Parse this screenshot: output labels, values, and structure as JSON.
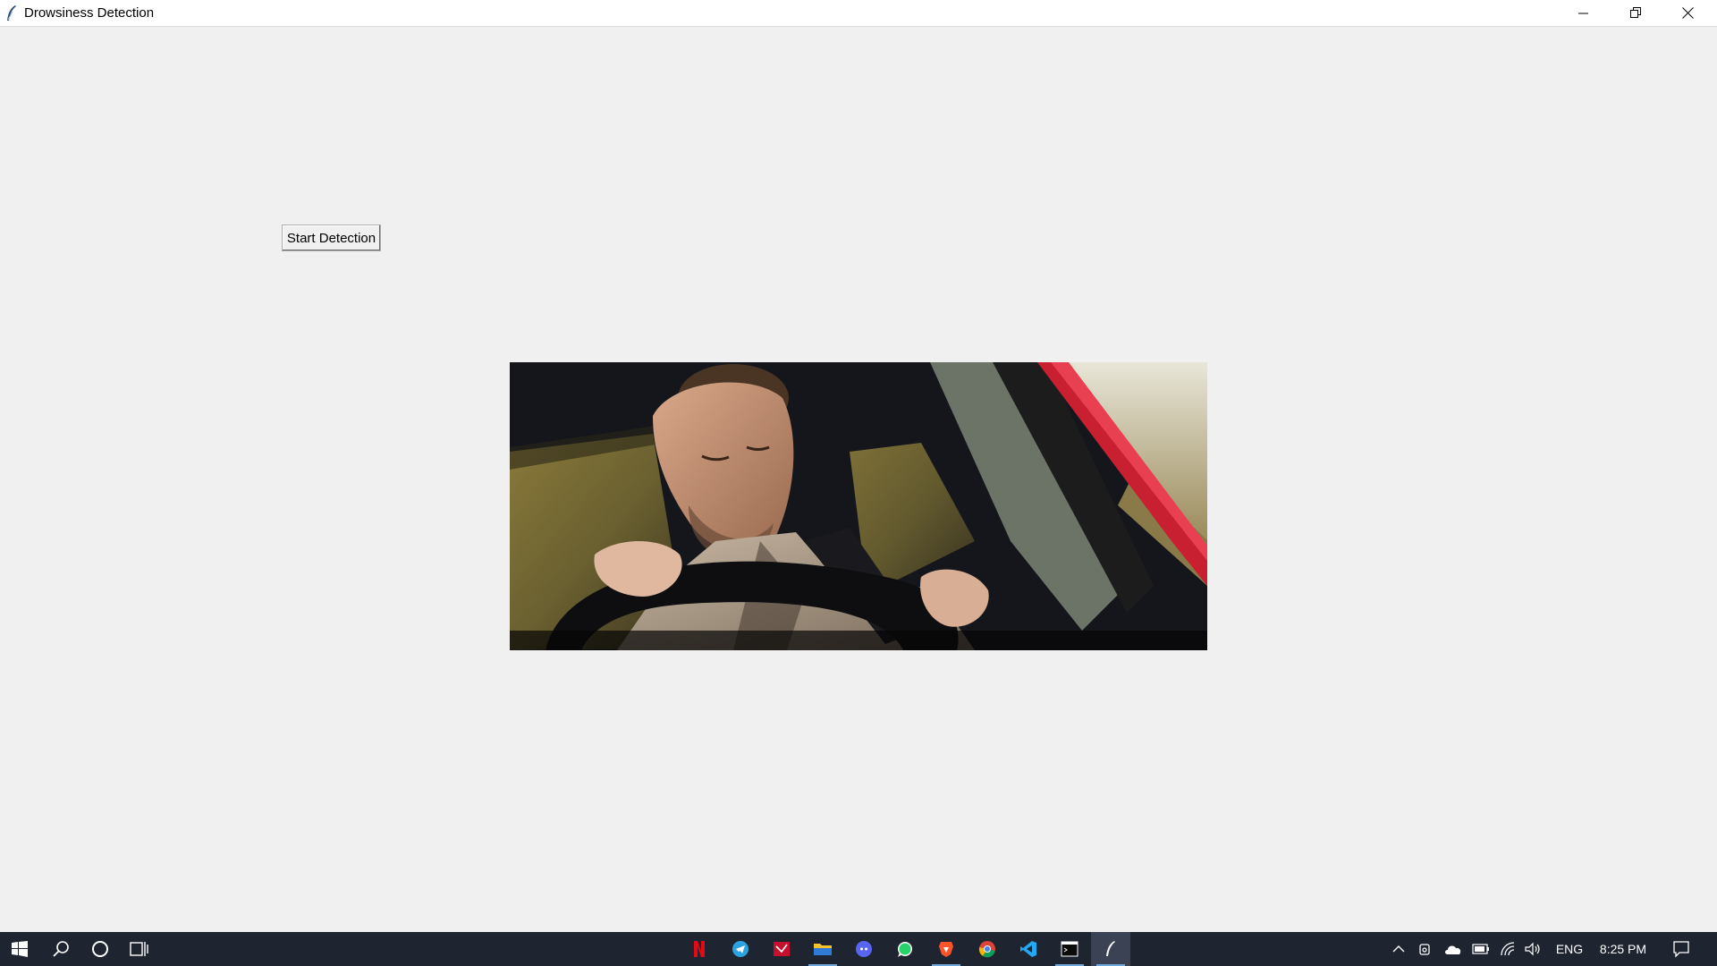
{
  "window": {
    "title": "Drowsiness Detection",
    "controls": [
      "minimize",
      "restore",
      "close"
    ]
  },
  "main": {
    "start_button_label": "Start Detection",
    "image": {
      "subject": "drowsy driver at steering wheel"
    }
  },
  "taskbar": {
    "left_icons": [
      "windows-start-icon",
      "search-icon",
      "cortana-icon",
      "task-view-icon"
    ],
    "apps": [
      {
        "name": "netflix-icon",
        "active": false
      },
      {
        "name": "telegram-icon",
        "active": false
      },
      {
        "name": "mail-icon",
        "active": false
      },
      {
        "name": "file-explorer-icon",
        "active": true
      },
      {
        "name": "discord-icon",
        "active": false
      },
      {
        "name": "whatsapp-icon",
        "active": false
      },
      {
        "name": "brave-icon",
        "active": true
      },
      {
        "name": "chrome-icon",
        "active": false
      },
      {
        "name": "vscode-icon",
        "active": false
      },
      {
        "name": "terminal-icon",
        "active": true
      },
      {
        "name": "python-tk-icon",
        "active": true
      }
    ],
    "tray": {
      "language": "ENG",
      "time": "8:25 PM"
    }
  },
  "colors": {
    "window_bg": "#f0f0f0",
    "taskbar_bg": "#1e2430",
    "active_indicator": "#6fa8dc"
  }
}
